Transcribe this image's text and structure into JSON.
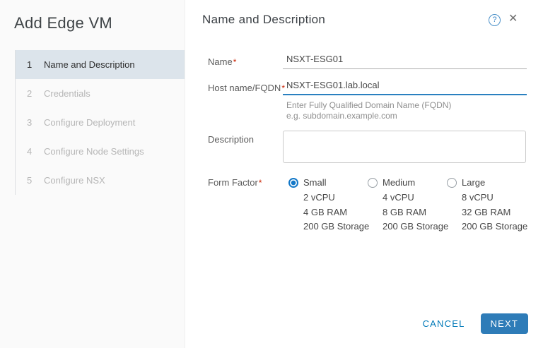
{
  "colors": {
    "accent_blue": "#0079b8",
    "focused_underline_blue": "#2a80c0",
    "primary_button_blue": "#2e7cb8",
    "active_step_bg": "#dce4eb",
    "required_red": "#c92100"
  },
  "sidebar": {
    "title": "Add Edge VM",
    "steps": [
      {
        "num": "1",
        "label": "Name and Description",
        "active": true
      },
      {
        "num": "2",
        "label": "Credentials",
        "active": false
      },
      {
        "num": "3",
        "label": "Configure Deployment",
        "active": false
      },
      {
        "num": "4",
        "label": "Configure Node Settings",
        "active": false
      },
      {
        "num": "5",
        "label": "Configure NSX",
        "active": false
      }
    ]
  },
  "header": {
    "title": "Name and Description",
    "help_glyph": "?",
    "close_glyph": "✕"
  },
  "form": {
    "required_marker": "*",
    "name": {
      "label": "Name",
      "value": "NSXT-ESG01"
    },
    "hostname": {
      "label": "Host name/FQDN",
      "value": "NSXT-ESG01.lab.local",
      "helper_line1": "Enter Fully Qualified Domain Name (FQDN)",
      "helper_line2": "e.g. subdomain.example.com"
    },
    "description": {
      "label": "Description",
      "value": ""
    },
    "form_factor": {
      "label": "Form Factor",
      "options": [
        {
          "label": "Small",
          "selected": true,
          "specs": [
            "2 vCPU",
            "4 GB RAM",
            "200 GB Storage"
          ]
        },
        {
          "label": "Medium",
          "selected": false,
          "specs": [
            "4 vCPU",
            "8 GB RAM",
            "200 GB Storage"
          ]
        },
        {
          "label": "Large",
          "selected": false,
          "specs": [
            "8 vCPU",
            "32 GB RAM",
            "200 GB Storage"
          ]
        }
      ]
    }
  },
  "footer": {
    "cancel_label": "CANCEL",
    "next_label": "NEXT"
  }
}
